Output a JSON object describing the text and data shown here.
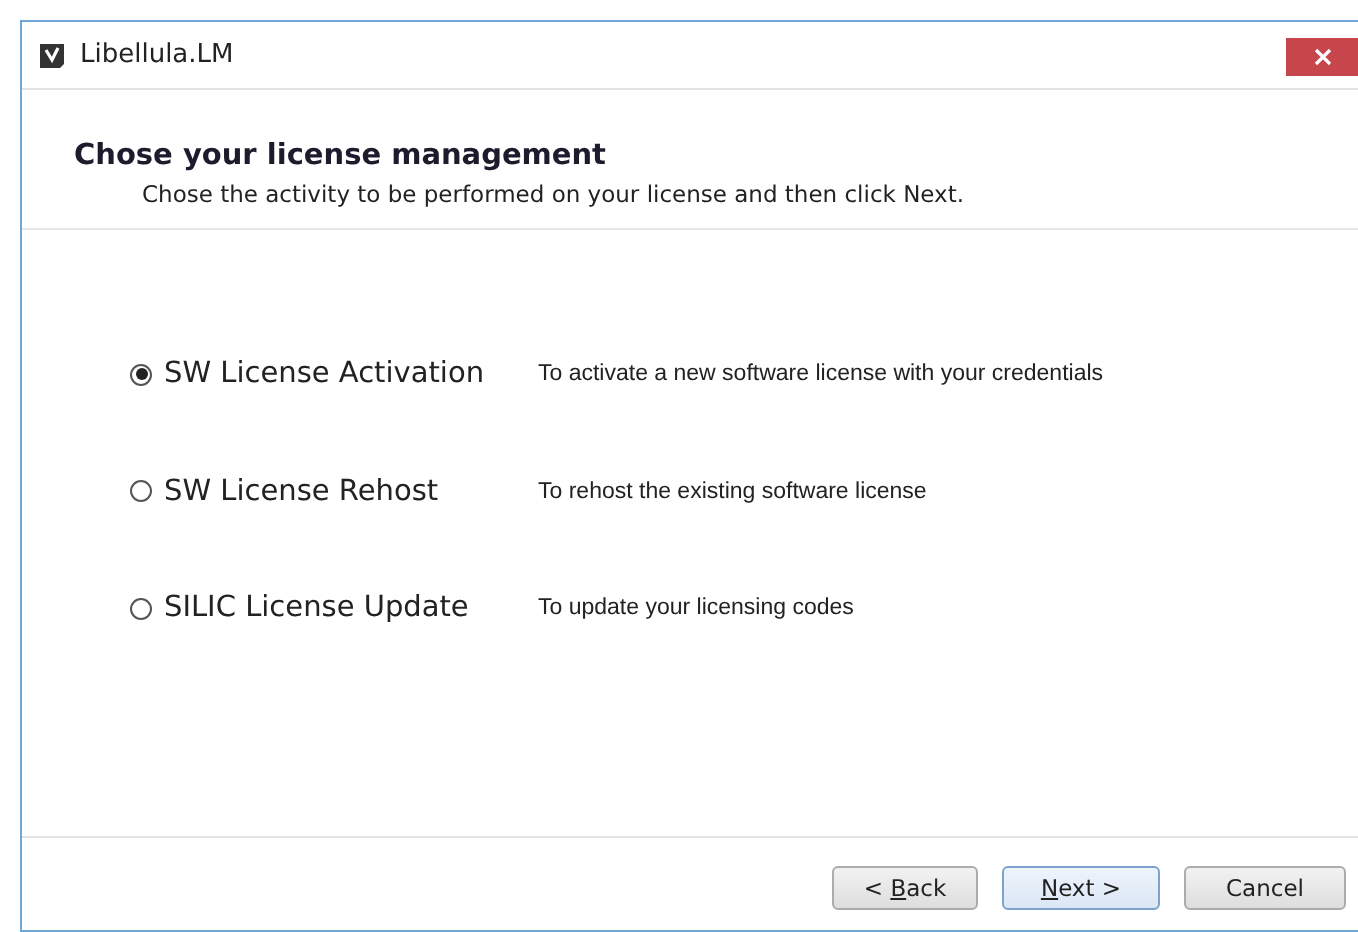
{
  "window": {
    "title": "Libellula.LM"
  },
  "header": {
    "title": "Chose your license management",
    "subtitle": "Chose the activity to be performed on your license and then click Next."
  },
  "options": [
    {
      "label": "SW License Activation",
      "description": "To activate a new software license with your credentials",
      "selected": true
    },
    {
      "label": "SW License Rehost",
      "description": "To rehost the existing software license",
      "selected": false
    },
    {
      "label": "SILIC License Update",
      "description": "To update your licensing codes",
      "selected": false
    }
  ],
  "buttons": [
    {
      "before": "< ",
      "key": "B",
      "after": "ack",
      "default": false
    },
    {
      "key": "N",
      "after": "ext >",
      "default": true
    },
    {
      "after": "Cancel",
      "default": false
    }
  ]
}
